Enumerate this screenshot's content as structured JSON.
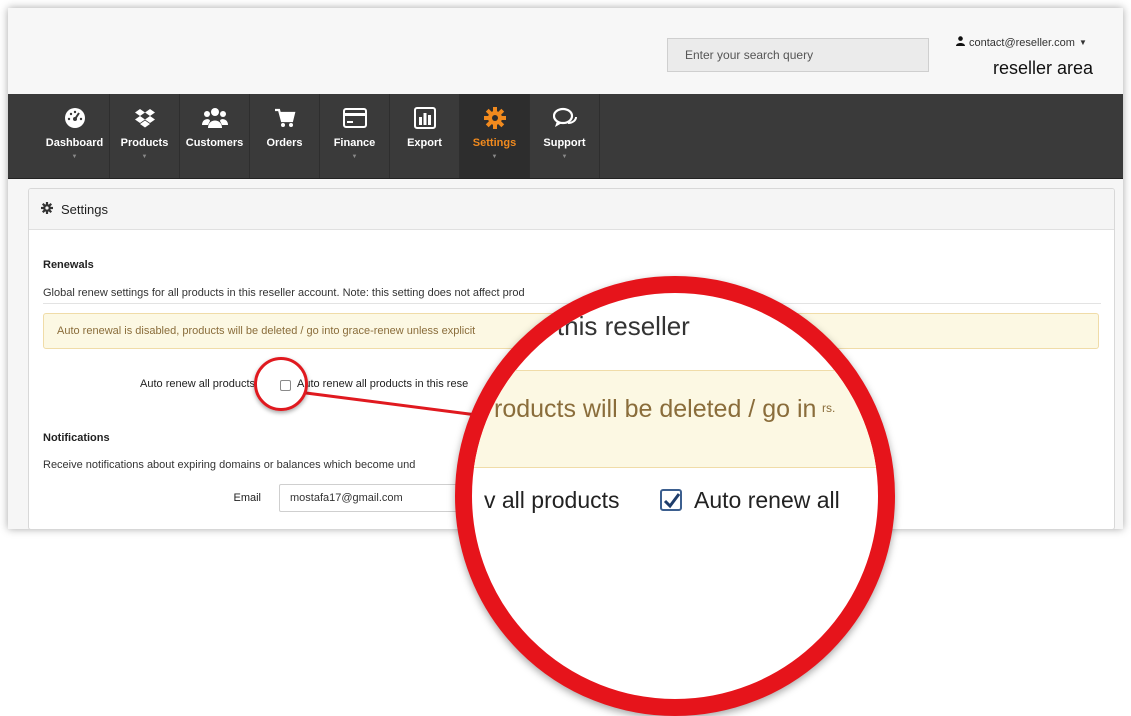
{
  "header": {
    "search_placeholder": "Enter your search query",
    "account_email": "contact@reseller.com",
    "area_title": "reseller area"
  },
  "nav": {
    "items": [
      {
        "label": "Dashboard",
        "icon": "dashboard-gauge-icon",
        "dropdown": true
      },
      {
        "label": "Products",
        "icon": "dropbox-box-icon",
        "dropdown": true
      },
      {
        "label": "Customers",
        "icon": "users-icon",
        "dropdown": false
      },
      {
        "label": "Orders",
        "icon": "shopping-cart-icon",
        "dropdown": false
      },
      {
        "label": "Finance",
        "icon": "credit-card-icon",
        "dropdown": true
      },
      {
        "label": "Export",
        "icon": "bar-chart-icon",
        "dropdown": false
      },
      {
        "label": "Settings",
        "icon": "gear-icon",
        "dropdown": true,
        "active": true
      },
      {
        "label": "Support",
        "icon": "chat-bubbles-icon",
        "dropdown": true
      }
    ],
    "accent_color": "#f18a1e",
    "background_color": "#3a3a3a"
  },
  "panel": {
    "title": "Settings",
    "renewals": {
      "title": "Renewals",
      "description": "Global renew settings for all products in this reseller account. Note: this setting does not affect prod",
      "alert": "Auto renewal is disabled, products will be deleted / go into grace-renew unless explicit",
      "auto_renew_label": "Auto renew all products",
      "auto_renew_checkbox_text": "Auto renew all products in this rese",
      "checked": false
    },
    "notifications": {
      "title": "Notifications",
      "description": "Receive notifications about expiring domains or balances which become und",
      "email_label": "Email",
      "email_value": "mostafa17@gmail.com"
    }
  },
  "magnifier": {
    "line1": "ts in this reseller",
    "line2": "roducts will be deleted / go in",
    "line2_tail": "rs.",
    "line3_left": "v all products",
    "line3_right": "Auto renew all",
    "checked": true,
    "ring_color": "#e6141b"
  }
}
